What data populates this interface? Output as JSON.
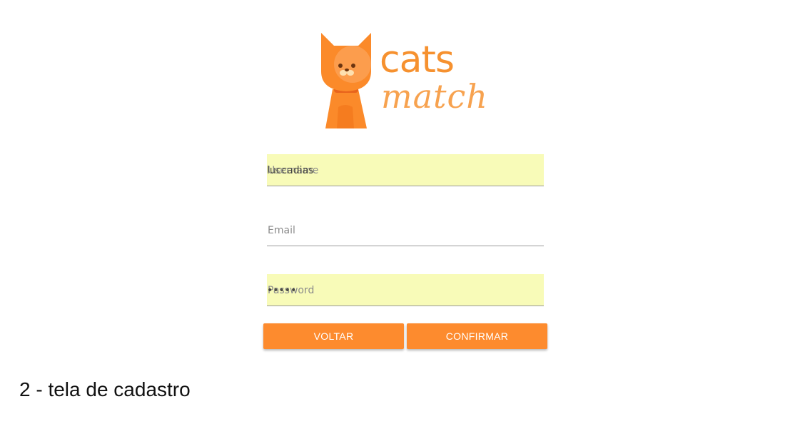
{
  "brand": {
    "word1": "cats",
    "word2": "match",
    "logo_icon": "cat-icon",
    "color_primary": "#f6912f"
  },
  "form": {
    "username": {
      "label": "Username",
      "value": "luccadias"
    },
    "email": {
      "label": "Email",
      "value": ""
    },
    "password": {
      "label": "Password",
      "value": "•••••"
    }
  },
  "buttons": {
    "back_label": "VOLTAR",
    "confirm_label": "CONFIRMAR",
    "color": "#fd8b2e"
  },
  "caption": "2 - tela de cadastro"
}
